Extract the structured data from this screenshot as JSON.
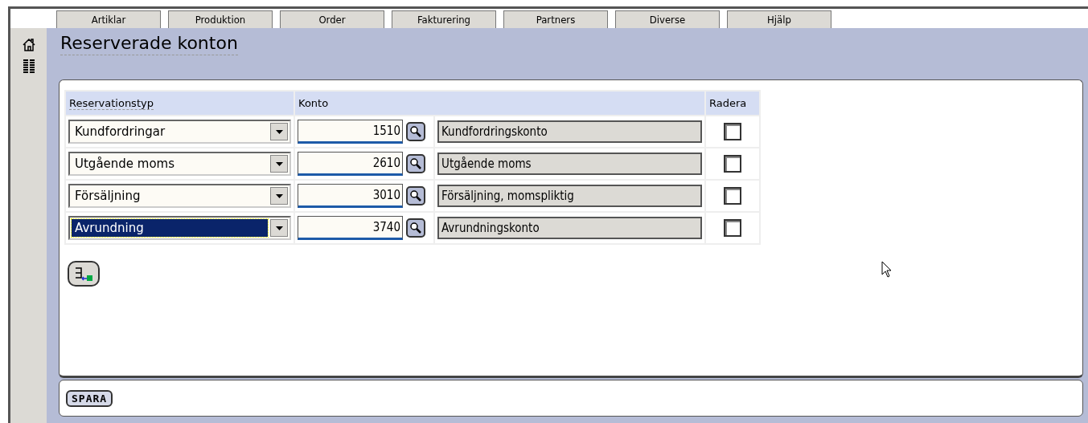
{
  "menu_tabs": [
    {
      "label": "Artiklar"
    },
    {
      "label": "Produktion"
    },
    {
      "label": "Order"
    },
    {
      "label": "Fakturering"
    },
    {
      "label": "Partners"
    },
    {
      "label": "Diverse"
    },
    {
      "label": "Hjälp"
    }
  ],
  "page_title": "Reserverade konton",
  "table": {
    "columns": [
      "Reservationstyp",
      "Konto",
      "Radera"
    ],
    "rows": [
      {
        "type": "Kundfordringar",
        "focused": false,
        "account": "1510",
        "description": "Kundfordringskonto",
        "delete": false
      },
      {
        "type": "Utgående moms",
        "focused": false,
        "account": "2610",
        "description": "Utgående moms",
        "delete": false
      },
      {
        "type": "Försäljning",
        "focused": false,
        "account": "3010",
        "description": "Försäljning, momspliktig",
        "delete": false
      },
      {
        "type": "Avrundning",
        "focused": true,
        "account": "3740",
        "description": "Avrundningskonto",
        "delete": false
      }
    ]
  },
  "save_button": "SPARA"
}
